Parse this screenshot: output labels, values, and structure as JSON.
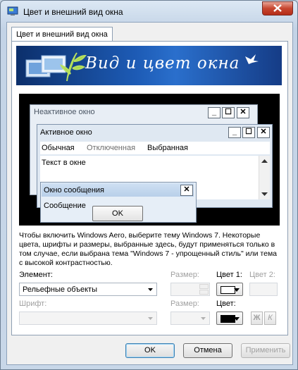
{
  "window": {
    "title": "Цвет и внешний вид окна"
  },
  "tab": {
    "label": "Цвет и внешний вид окна"
  },
  "banner": {
    "title": "Вид и цвет окна"
  },
  "preview": {
    "inactive_title": "Неактивное окно",
    "active_title": "Активное окно",
    "menu": [
      "Обычная",
      "Отключенная",
      "Выбранная"
    ],
    "window_text": "Текст в окне",
    "message_title": "Окно сообщения",
    "message_text": "Сообщение",
    "message_ok": "OK"
  },
  "info_text": "Чтобы включить Windows Aero, выберите тему Windows 7. Некоторые цвета, шрифты и размеры, выбранные здесь, будут применяться только в том случае, если выбрана тема \"Windows 7 - упрощенный стиль\" или тема с высокой контрастностью.",
  "element": {
    "label": "Элемент:",
    "value": "Рельефные объекты"
  },
  "size1": {
    "label": "Размер:"
  },
  "color1": {
    "label": "Цвет 1:",
    "color": "#ffffff"
  },
  "color2": {
    "label": "Цвет 2:"
  },
  "font": {
    "label": "Шрифт:"
  },
  "size2": {
    "label": "Размер:"
  },
  "color": {
    "label": "Цвет:",
    "color": "#000000"
  },
  "bold_label": "Ж",
  "italic_label": "К",
  "buttons": {
    "ok": "OK",
    "cancel": "Отмена",
    "apply": "Применить"
  }
}
